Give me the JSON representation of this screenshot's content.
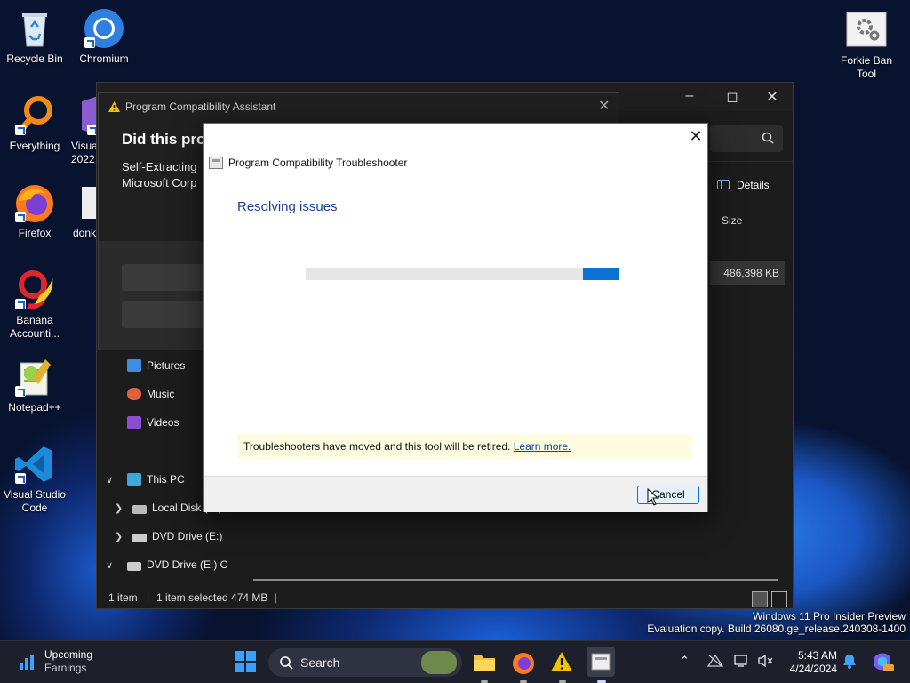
{
  "desktop": {
    "icons": [
      {
        "label": "Recycle Bin"
      },
      {
        "label": "Chromium"
      },
      {
        "label": "Everything"
      },
      {
        "label": "Visual Studio 2022",
        "partial_label_line1": "Visua",
        "partial_label_line2": "2022"
      },
      {
        "label": "Firefox"
      },
      {
        "label": "donk",
        "partial_label": "donk"
      },
      {
        "label": "Banana Accounti..."
      },
      {
        "label": "Notepad++"
      },
      {
        "label": "Visual Studio Code"
      },
      {
        "label": "Forkie Ban Tool"
      }
    ]
  },
  "explorer": {
    "details_label": "Details",
    "col_size": "Size",
    "file_size": "486,398 KB",
    "nav": {
      "pictures": "Pictures",
      "music": "Music",
      "videos": "Videos",
      "this_pc": "This PC",
      "local_disk": "Local Disk (C:)",
      "dvd_drive": "DVD Drive (E:)",
      "dvd_drive2": "DVD Drive (E:) C"
    },
    "status": {
      "count": "1 item",
      "selected": "1 item selected  474 MB"
    }
  },
  "pca": {
    "title": "Program Compatibility Assistant",
    "heading": "Did this pro",
    "line1": "Self-Extracting",
    "line2": "Microsoft Corp"
  },
  "dialog": {
    "title": "Program Compatibility Troubleshooter",
    "status": "Resolving issues",
    "progress": {
      "fill_start": 0.885,
      "fill_end": 1.0
    },
    "notice_text": "Troubleshooters have moved and this tool will be retired. ",
    "notice_link": "Learn more.",
    "cancel_label": "Cancel"
  },
  "watermark": {
    "line1": "Windows 11 Pro Insider Preview",
    "line2": "Evaluation copy. Build 26080.ge_release.240308-1400"
  },
  "taskbar": {
    "weather_line1": "Upcoming",
    "weather_line2": "Earnings",
    "search_label": "Search",
    "clock_time": "5:43 AM",
    "clock_date": "4/24/2024"
  },
  "colors": {
    "accent": "#0a72d4",
    "dialog_heading": "#1c3f94",
    "notice_bg": "#fdfbe0"
  }
}
